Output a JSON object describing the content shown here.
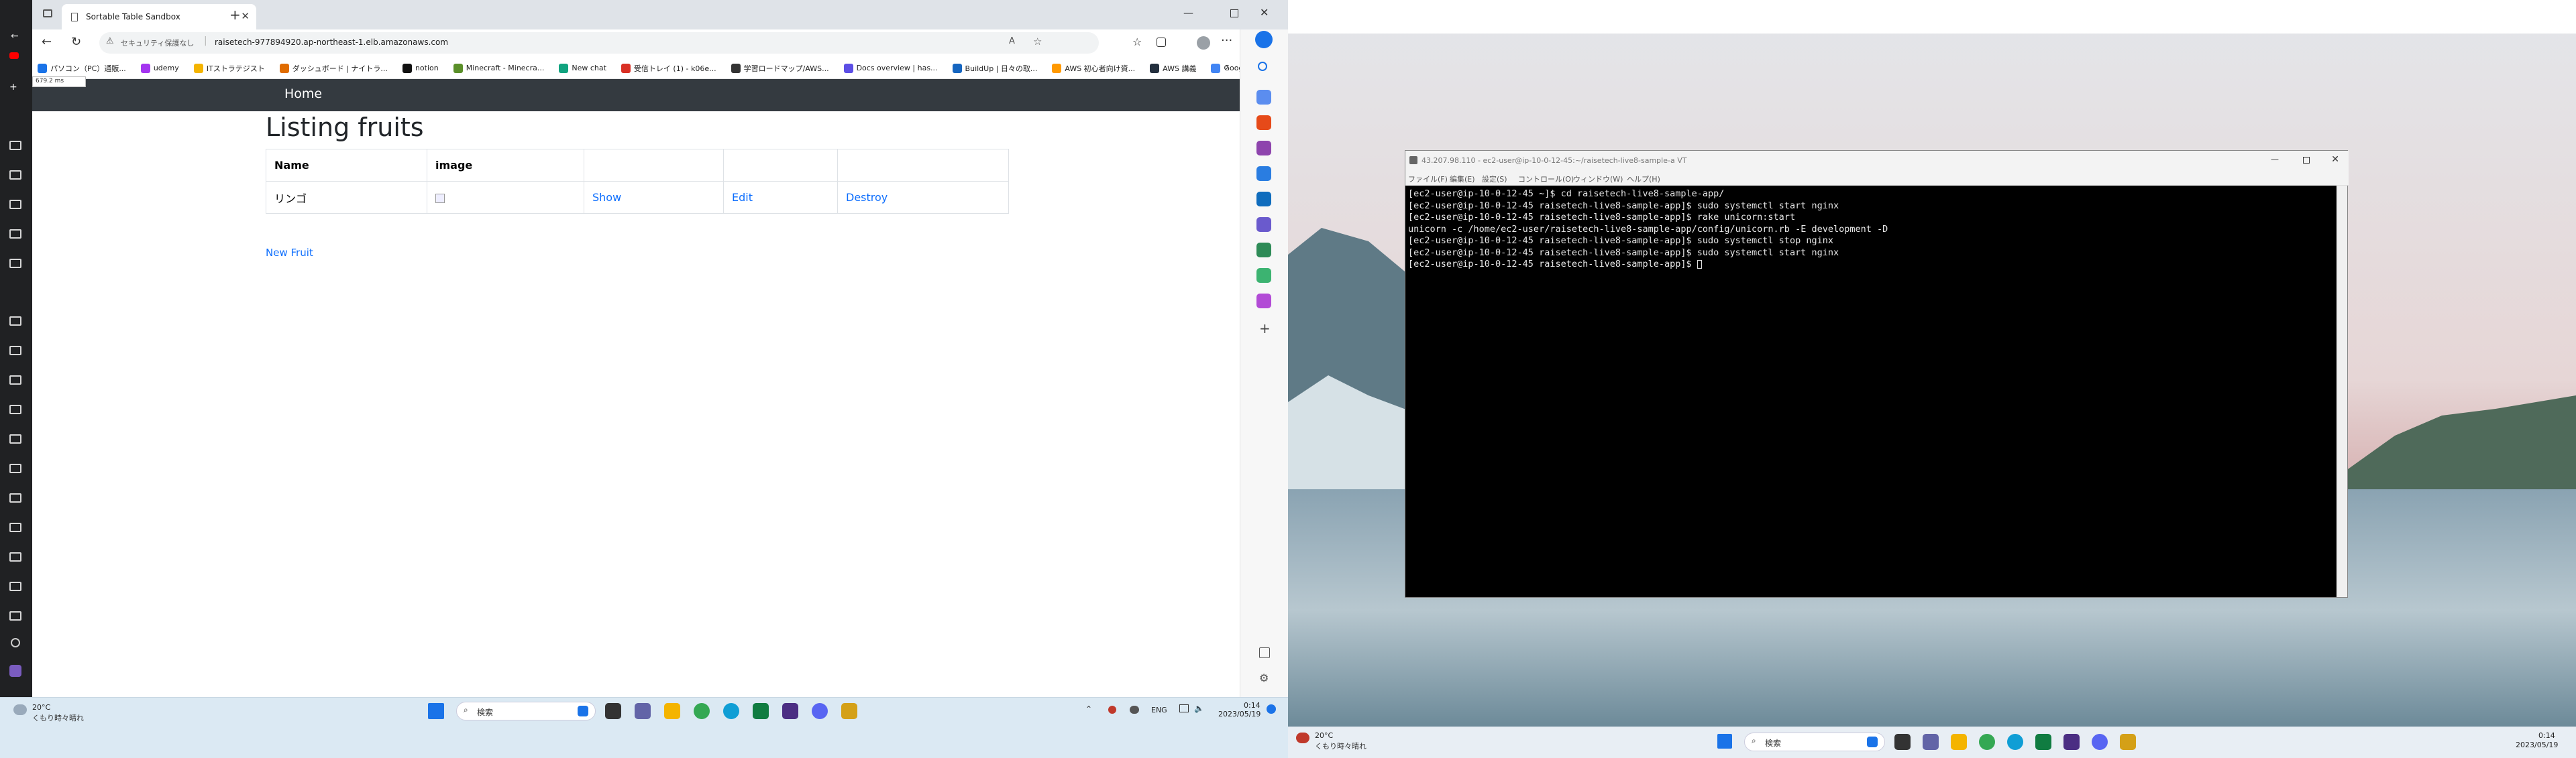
{
  "left_screen": {
    "browser": {
      "tab_title": "Sortable Table Sandbox",
      "security_label": "セキュリティ保護なし",
      "url": "raisetech-977894920.ap-northeast-1.elb.amazonaws.com",
      "tooltip": "679.2 ms",
      "bookmarks": [
        {
          "label": "パソコン（PC）通販...",
          "color": "#1a73e8"
        },
        {
          "label": "udemy",
          "color": "#a435f0"
        },
        {
          "label": "ITストラテジスト",
          "color": "#f4b400"
        },
        {
          "label": "ダッシュボード | ナイトラ...",
          "color": "#e06c00"
        },
        {
          "label": "notion",
          "color": "#111111"
        },
        {
          "label": "Minecraft - Minecra...",
          "color": "#5a8f29"
        },
        {
          "label": "New chat",
          "color": "#10a37f"
        },
        {
          "label": "受信トレイ (1) - k06e...",
          "color": "#d93025"
        },
        {
          "label": "学習ロードマップ/AWS...",
          "color": "#333333"
        },
        {
          "label": "Docs overview | has...",
          "color": "#5c4ee5"
        },
        {
          "label": "BuildUp | 日々の取...",
          "color": "#1565c0"
        },
        {
          "label": "AWS 初心者向け資...",
          "color": "#ff9900"
        },
        {
          "label": "AWS 講義",
          "color": "#232f3e"
        },
        {
          "label": "Google",
          "color": "#4285f4"
        }
      ],
      "page": {
        "nav_home": "Home",
        "heading": "Listing fruits",
        "table": {
          "headers": [
            "Name",
            "image",
            "",
            "",
            ""
          ],
          "rows": [
            [
              "リンゴ",
              "",
              "Show",
              "Edit",
              "Destroy"
            ]
          ]
        },
        "new_link": "New Fruit"
      }
    },
    "taskbar": {
      "weather_temp": "20°C",
      "weather_desc": "くもり時々晴れ",
      "search": "検索",
      "lang": "ENG",
      "time": "0:14",
      "date": "2023/05/19"
    }
  },
  "right_screen": {
    "terminal": {
      "title": "43.207.98.110 - ec2-user@ip-10-0-12-45:~/raisetech-live8-sample-a VT",
      "menu": [
        "ファイル(F)",
        "編集(E)",
        "設定(S)",
        "コントロール(O)",
        "ウィンドウ(W)",
        "ヘルプ(H)"
      ],
      "lines": [
        "[ec2-user@ip-10-0-12-45 ~]$ cd raisetech-live8-sample-app/",
        "[ec2-user@ip-10-0-12-45 raisetech-live8-sample-app]$ sudo systemctl start nginx",
        "[ec2-user@ip-10-0-12-45 raisetech-live8-sample-app]$ rake unicorn:start",
        "unicorn -c /home/ec2-user/raisetech-live8-sample-app/config/unicorn.rb -E development -D",
        "[ec2-user@ip-10-0-12-45 raisetech-live8-sample-app]$ sudo systemctl stop nginx",
        "[ec2-user@ip-10-0-12-45 raisetech-live8-sample-app]$ sudo systemctl start nginx",
        "[ec2-user@ip-10-0-12-45 raisetech-live8-sample-app]$ "
      ]
    },
    "taskbar": {
      "weather_temp": "20°C",
      "weather_desc": "くもり時々晴れ",
      "search": "検索",
      "time": "0:14",
      "date": "2023/05/19"
    }
  }
}
